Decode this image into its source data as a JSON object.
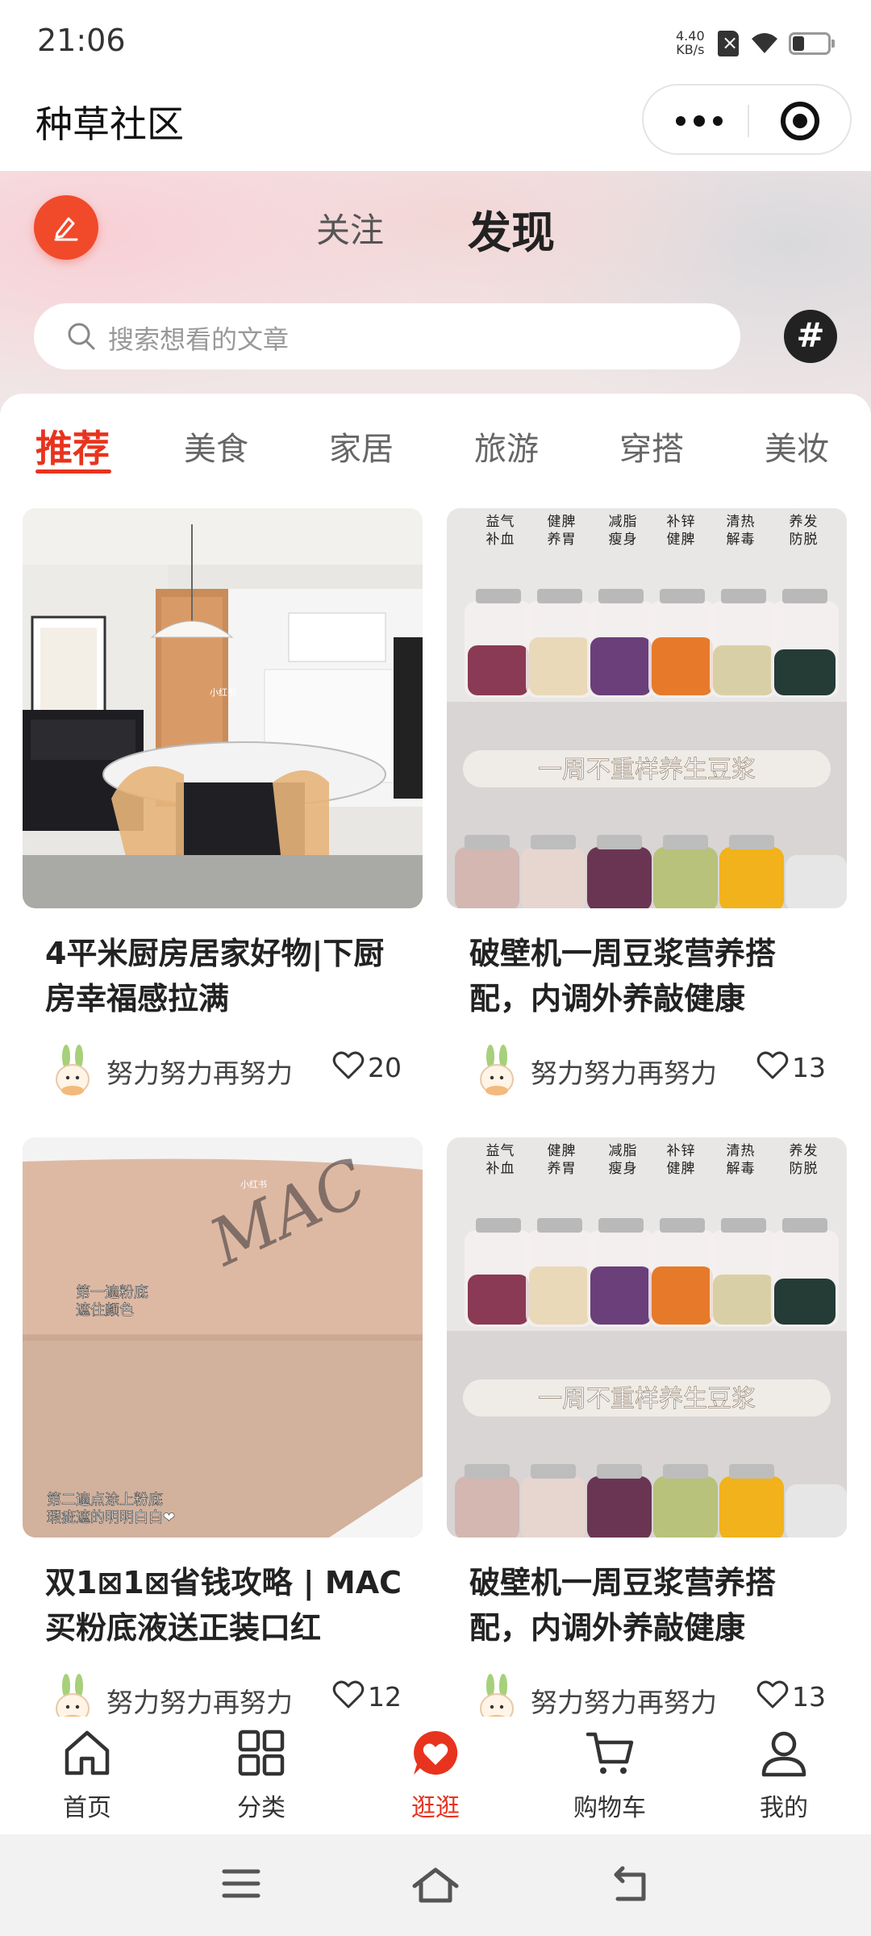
{
  "status_bar": {
    "time": "21:06",
    "speed_value": "4.40",
    "speed_unit": "KB/s"
  },
  "nav_bar": {
    "title": "种草社区"
  },
  "header": {
    "tabs": [
      {
        "label": "关注"
      },
      {
        "label": "发现"
      }
    ],
    "active_tab": "发现",
    "search": {
      "placeholder": "搜索想看的文章"
    }
  },
  "categories": [
    {
      "label": "推荐"
    },
    {
      "label": "美食"
    },
    {
      "label": "家居"
    },
    {
      "label": "旅游"
    },
    {
      "label": "穿搭"
    },
    {
      "label": "美妆"
    }
  ],
  "active_category": "推荐",
  "feed": {
    "cards": [
      {
        "title": "4平米厨房居家好物|下厨房幸福感拉满",
        "author": "努力努力再努力",
        "likes": "20",
        "image": {
          "type": "kitchen-photo",
          "watermark": "小红书"
        }
      },
      {
        "title": "破壁机一周豆浆营养搭配，内调外养敲健康",
        "author": "努力努力再努力",
        "likes": "13",
        "image": {
          "type": "soymilk-jars-photo",
          "labels": [
            "益气补血",
            "健脾养胃",
            "减脂瘦身",
            "补锌健脾",
            "清热解毒",
            "养发防脱"
          ],
          "caption": "一周不重样养生豆浆"
        }
      },
      {
        "title": "双1⊠1⊠省钱攻略 | MAC买粉底液送正装口红",
        "author": "努力努力再努力",
        "likes": "12",
        "image": {
          "type": "foundation-swatch-photo",
          "brand_text": "MAC",
          "note_top": "第一遍粉底\n遮住颜色",
          "note_bottom": "第二遍点涂上粉底\n瑕疵遮的明明白白❤",
          "watermark": "小红书"
        }
      },
      {
        "title": "破壁机一周豆浆营养搭配，内调外养敲健康",
        "author": "努力努力再努力",
        "likes": "13",
        "image": {
          "type": "soymilk-jars-photo",
          "labels": [
            "益气补血",
            "健脾养胃",
            "减脂瘦身",
            "补锌健脾",
            "清热解毒",
            "养发防脱"
          ],
          "caption": "一周不重样养生豆浆"
        }
      }
    ]
  },
  "tab_bar": {
    "items": [
      {
        "label": "首页",
        "icon": "home-icon"
      },
      {
        "label": "分类",
        "icon": "category-grid-icon"
      },
      {
        "label": "逛逛",
        "icon": "heart-bubble-icon"
      },
      {
        "label": "购物车",
        "icon": "cart-icon"
      },
      {
        "label": "我的",
        "icon": "profile-icon"
      }
    ],
    "active": "逛逛"
  },
  "colors": {
    "accent": "#e8331e",
    "edit_button": "#f04a2a",
    "text_primary": "#222222",
    "text_secondary": "#666666"
  }
}
